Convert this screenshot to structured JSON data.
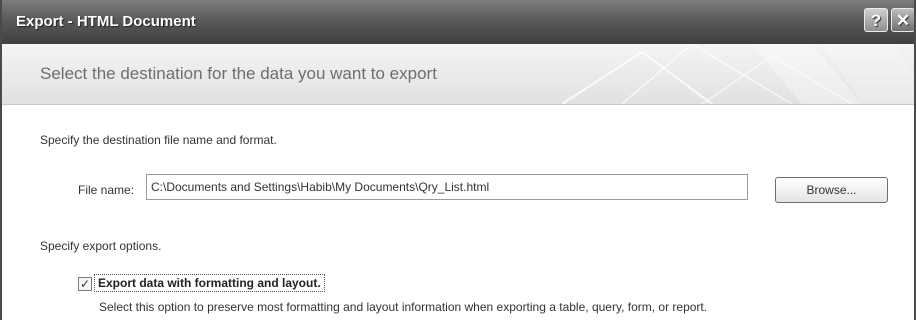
{
  "window": {
    "title": "Export - HTML Document",
    "help_button": "?",
    "close_button": "✕"
  },
  "banner": {
    "heading": "Select the destination for the data you want to export"
  },
  "destination": {
    "instruction": "Specify the destination file name and format.",
    "file_name_label": "File name:",
    "file_name_value": "C:\\Documents and Settings\\Habib\\My Documents\\Qry_List.html",
    "browse_label": "Browse..."
  },
  "options": {
    "heading": "Specify export options.",
    "export_formatting": {
      "checked": true,
      "label": "Export data with formatting and layout.",
      "description": "Select this option to preserve most formatting and layout information when exporting a table, query, form, or report."
    }
  }
}
